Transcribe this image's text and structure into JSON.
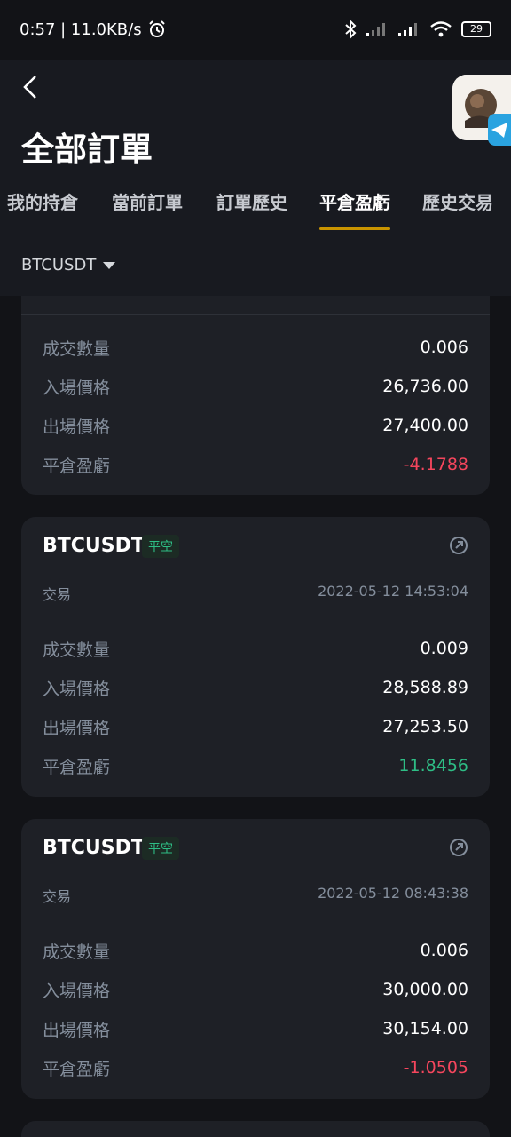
{
  "status_bar": {
    "time_speed": "0:57 | 11.0KB/s",
    "battery": "29"
  },
  "page": {
    "title": "全部訂單"
  },
  "tabs": [
    {
      "label": "我的持倉"
    },
    {
      "label": "當前訂單"
    },
    {
      "label": "訂單歷史"
    },
    {
      "label": "平倉盈虧",
      "active": true
    },
    {
      "label": "歷史交易"
    }
  ],
  "filter": {
    "symbol": "BTCUSDT"
  },
  "colors": {
    "accent": "#c99400",
    "profit": "#2ebd85",
    "loss": "#f6465d",
    "background": "#121317",
    "card": "#1e2026"
  },
  "cards": [
    {
      "rows": [
        {
          "label": "成交數量",
          "value": "0.006"
        },
        {
          "label": "入場價格",
          "value": "26,736.00"
        },
        {
          "label": "出場價格",
          "value": "27,400.00"
        },
        {
          "label": "平倉盈虧",
          "value": "-4.1788"
        }
      ]
    },
    {
      "symbol": "BTCUSDT",
      "side": "平空",
      "type": "交易",
      "time": "2022-05-12 14:53:04",
      "rows": [
        {
          "label": "成交數量",
          "value": "0.009"
        },
        {
          "label": "入場價格",
          "value": "28,588.89"
        },
        {
          "label": "出場價格",
          "value": "27,253.50"
        },
        {
          "label": "平倉盈虧",
          "value": "11.8456"
        }
      ]
    },
    {
      "symbol": "BTCUSDT",
      "side": "平空",
      "type": "交易",
      "time": "2022-05-12 08:43:38",
      "rows": [
        {
          "label": "成交數量",
          "value": "0.006"
        },
        {
          "label": "入場價格",
          "value": "30,000.00"
        },
        {
          "label": "出場價格",
          "value": "30,154.00"
        },
        {
          "label": "平倉盈虧",
          "value": "-1.0505"
        }
      ]
    }
  ]
}
